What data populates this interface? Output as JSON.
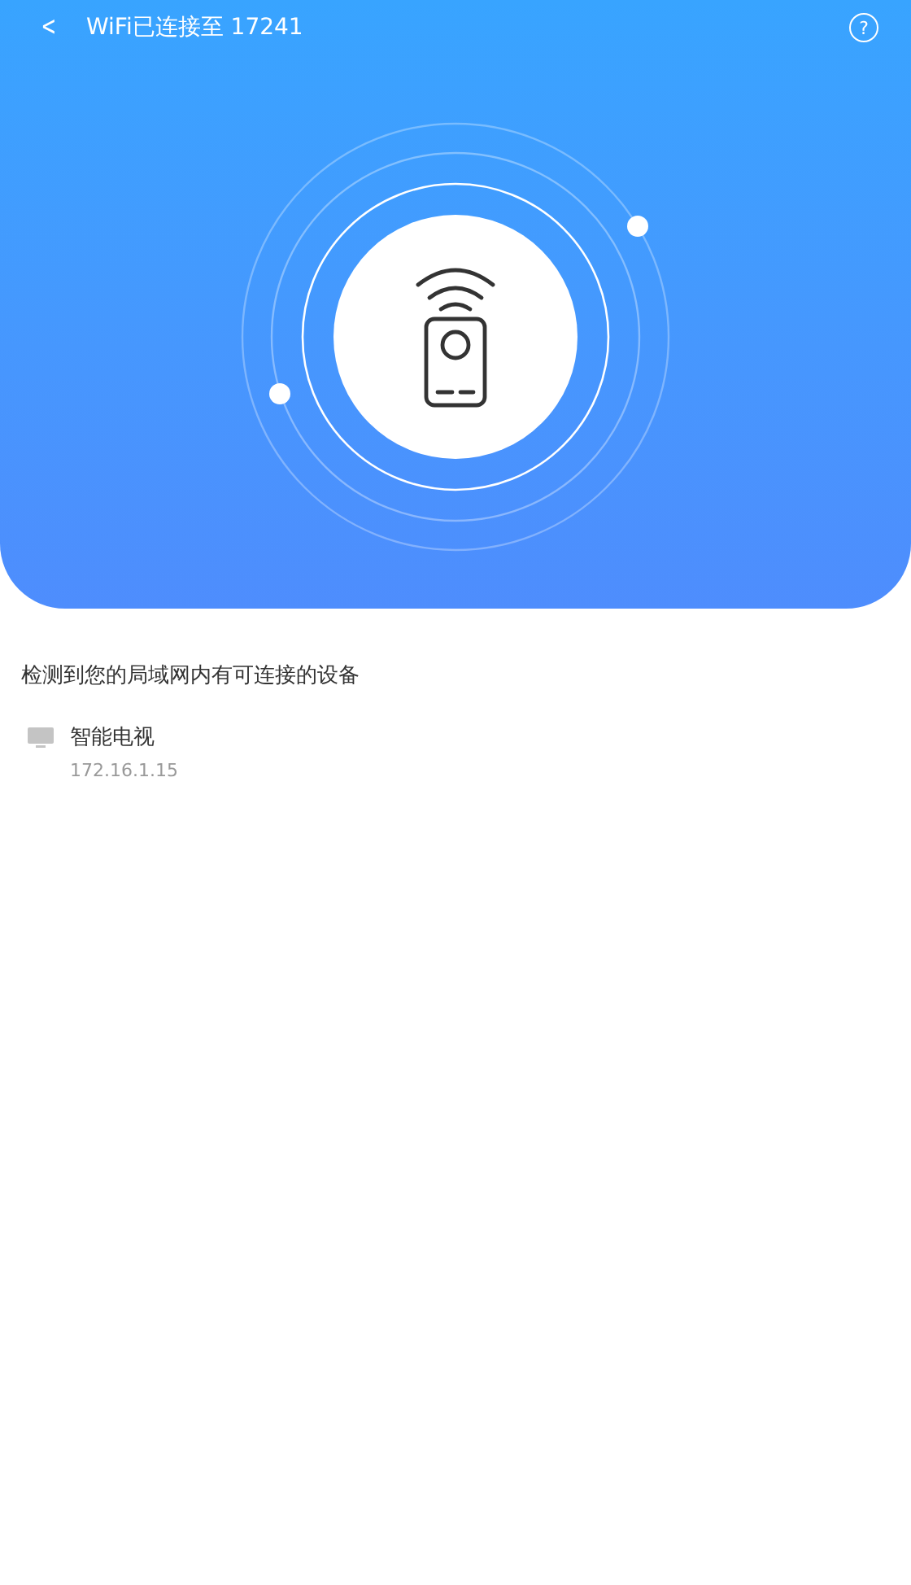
{
  "header": {
    "back": "<",
    "title": "WiFi已连接至 17241",
    "help": "?"
  },
  "section_title": "检测到您的局域网内有可连接的设备",
  "devices": [
    {
      "name": "智能电视",
      "ip": "172.16.1.15"
    }
  ]
}
